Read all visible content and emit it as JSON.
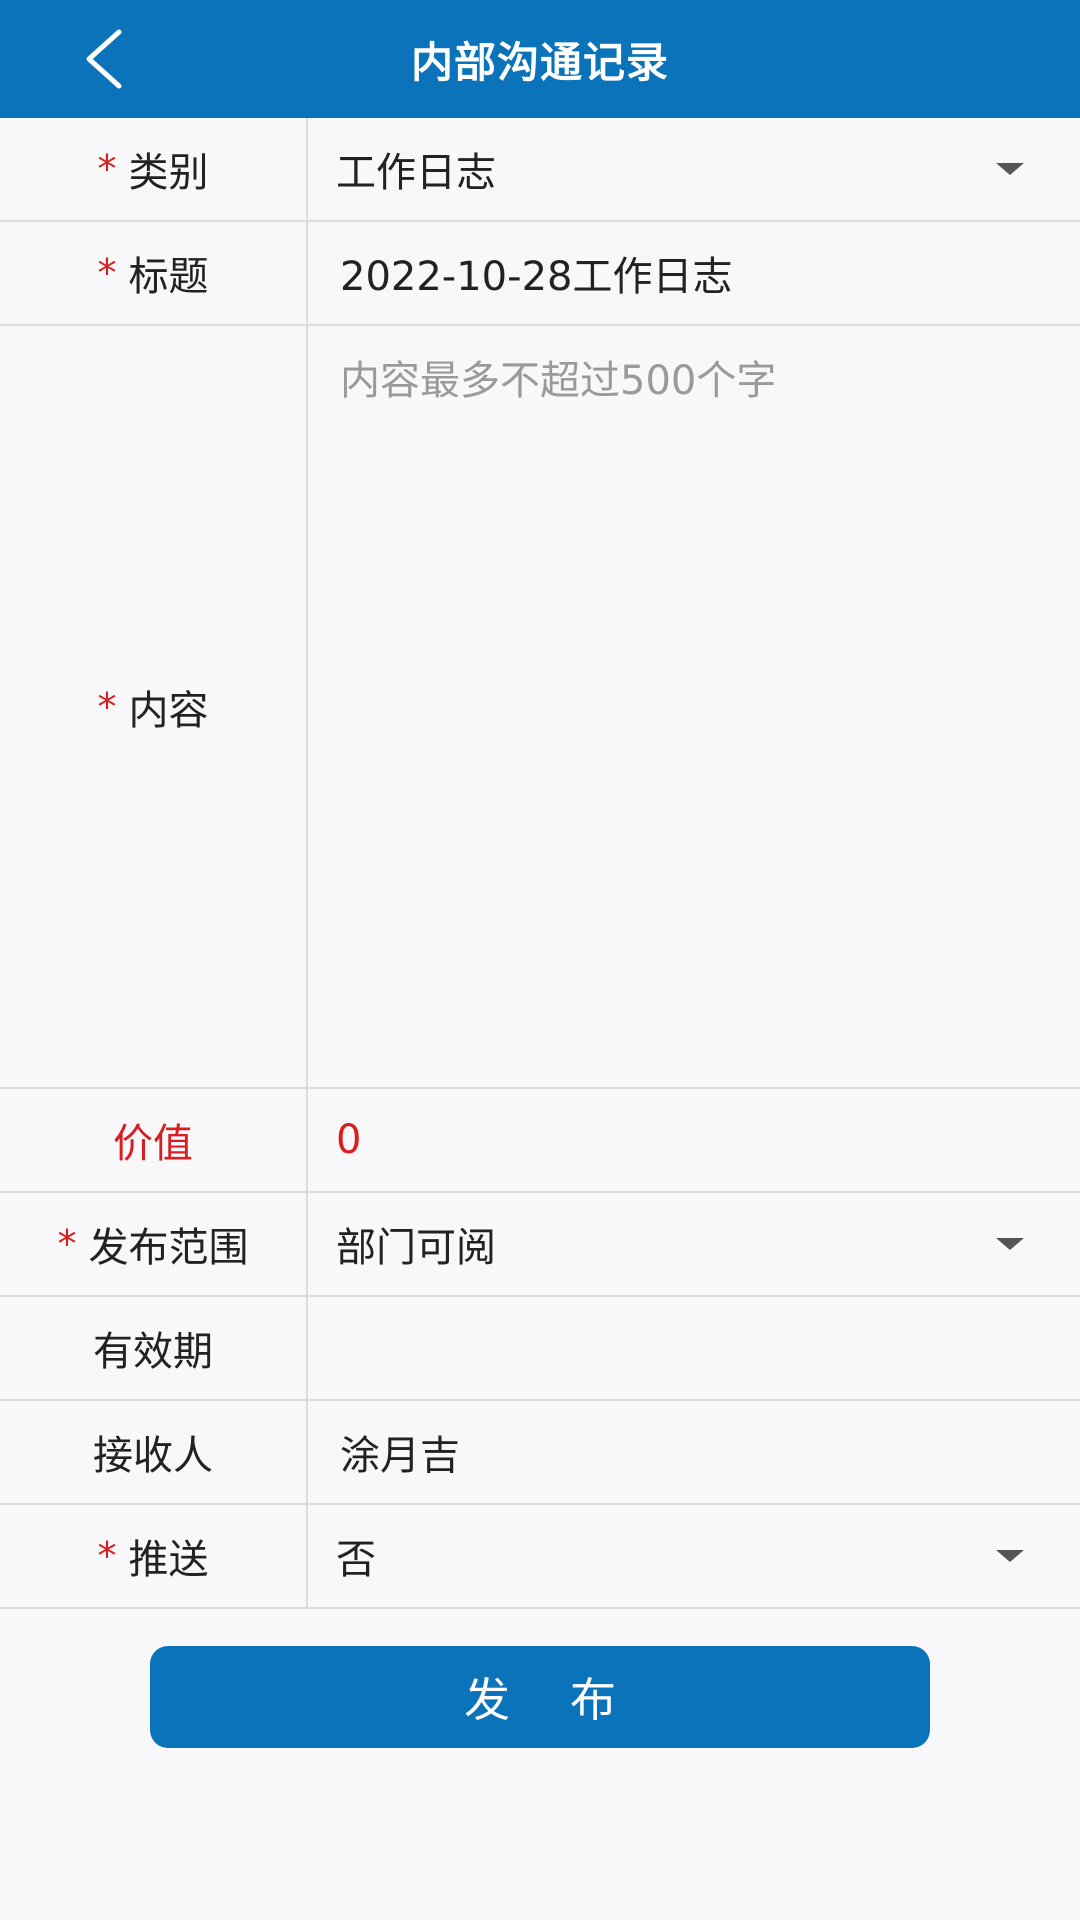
{
  "header": {
    "title": "内部沟通记录",
    "back_icon": "chevron-left-icon"
  },
  "form": {
    "category": {
      "label": "类别",
      "required": true,
      "value": "工作日志"
    },
    "title": {
      "label": "标题",
      "required": true,
      "value": "2022-10-28工作日志"
    },
    "content": {
      "label": "内容",
      "required": true,
      "value": "",
      "placeholder": "内容最多不超过500个字"
    },
    "worth": {
      "label": "价值",
      "required": false,
      "value": "0"
    },
    "scope": {
      "label": "发布范围",
      "required": true,
      "value": "部门可阅"
    },
    "validity": {
      "label": "有效期",
      "required": false,
      "value": ""
    },
    "receiver": {
      "label": "接收人",
      "required": false,
      "value": "涂月吉"
    },
    "push": {
      "label": "推送",
      "required": true,
      "value": "否"
    }
  },
  "submit": {
    "label": "发布"
  },
  "colors": {
    "primary": "#0a73ba",
    "required_star": "#d81e1e",
    "border": "#dcdcdc",
    "background": "#f8f8fa"
  }
}
